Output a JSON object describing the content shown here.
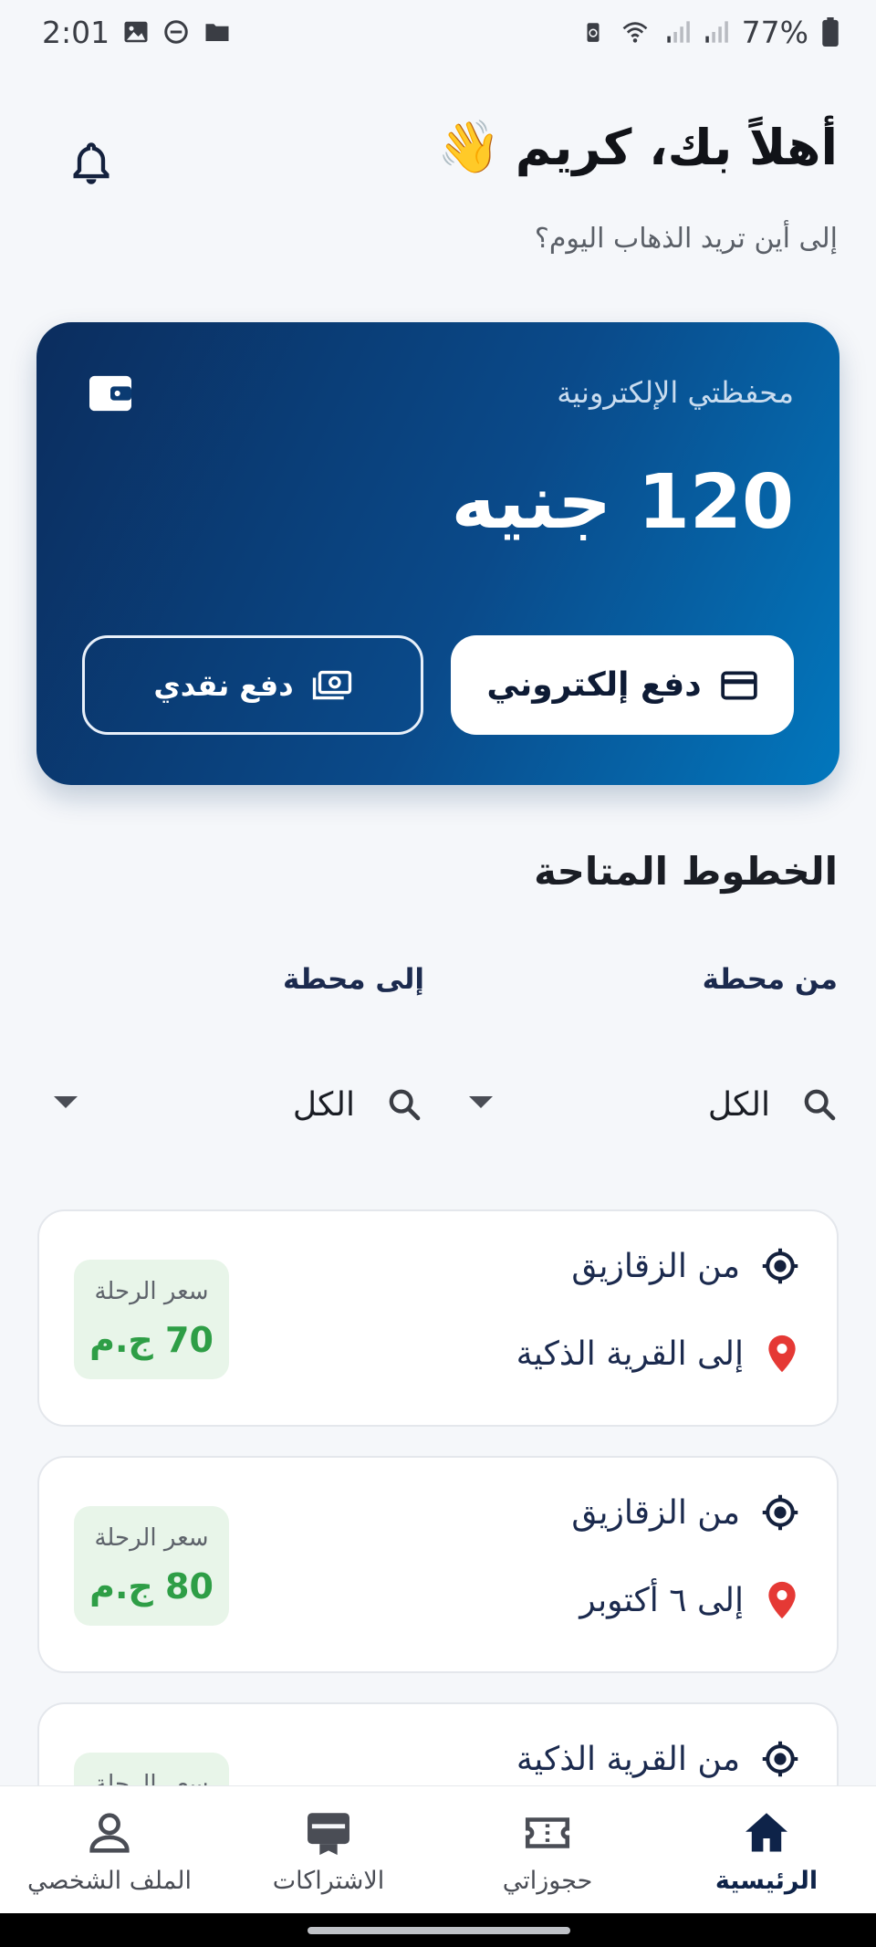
{
  "status_bar": {
    "time": "2:01",
    "battery": "77%"
  },
  "header": {
    "greeting": "أهلاً بك، كريم",
    "wave_emoji": "👋",
    "subtitle": "إلى أين تريد الذهاب اليوم؟"
  },
  "wallet": {
    "label": "محفظتي الإلكترونية",
    "balance": "120 جنيه",
    "epay_label": "دفع إلكتروني",
    "cash_label": "دفع نقدي"
  },
  "lines": {
    "title": "الخطوط المتاحة",
    "from_label": "من محطة",
    "to_label": "إلى محطة",
    "from_value": "الكل",
    "to_value": "الكل"
  },
  "routes": [
    {
      "from": "من الزقازيق",
      "to": "إلى القرية الذكية",
      "price_label": "سعر الرحلة",
      "price": "70 ج.م"
    },
    {
      "from": "من الزقازيق",
      "to": "إلى ٦ أكتوبر",
      "price_label": "سعر الرحلة",
      "price": "80 ج.م"
    },
    {
      "from": "من القرية الذكية",
      "price_label": "سعر الرحلة"
    }
  ],
  "nav": {
    "home": "الرئيسية",
    "bookings": "حجوزاتي",
    "subscriptions": "الاشتراكات",
    "profile": "الملف الشخصي"
  },
  "colors": {
    "primary_dark": "#0e2349",
    "wallet_gradient_start": "#0b2d5e",
    "wallet_gradient_end": "#0277bd",
    "price_green": "#2e9e46",
    "pin_red": "#e53935"
  }
}
